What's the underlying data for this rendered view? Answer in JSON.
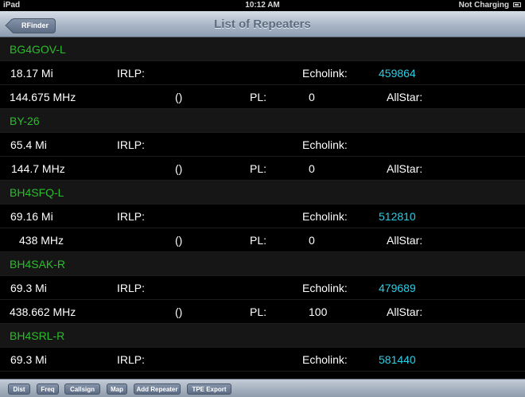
{
  "status_bar": {
    "device": "iPad",
    "time": "10:12 AM",
    "charging": "Not Charging"
  },
  "nav": {
    "back_label": "RFinder",
    "title": "List of Repeaters"
  },
  "labels": {
    "irlp": "IRLP:",
    "echolink": "Echolink:",
    "pl": "PL:",
    "allstar": "AllStar:",
    "paren": "()"
  },
  "repeaters": [
    {
      "callsign": "BG4GOV-L",
      "distance": "18.17 Mi",
      "echolink": "459864",
      "frequency": "144.675 MHz",
      "pl": "0"
    },
    {
      "callsign": "BY-26",
      "distance": "65.4 Mi",
      "echolink": "",
      "frequency": "144.7 MHz",
      "pl": "0"
    },
    {
      "callsign": "BH4SFQ-L",
      "distance": "69.16 Mi",
      "echolink": "512810",
      "frequency": "438 MHz",
      "pl": "0"
    },
    {
      "callsign": "BH4SAK-R",
      "distance": "69.3 Mi",
      "echolink": "479689",
      "frequency": "438.662 MHz",
      "pl": "100"
    },
    {
      "callsign": "BH4SRL-R",
      "distance": "69.3 Mi",
      "echolink": "581440"
    }
  ],
  "toolbar": {
    "dist": "Dist",
    "freq": "Freq",
    "callsign": "Callsign",
    "map": "Map",
    "add_repeater": "Add Repeater",
    "tpe_export": "TPE Export"
  },
  "colors": {
    "callsign": "#2bbd2b",
    "echolink_value": "#28d0e8",
    "background": "#000000"
  }
}
